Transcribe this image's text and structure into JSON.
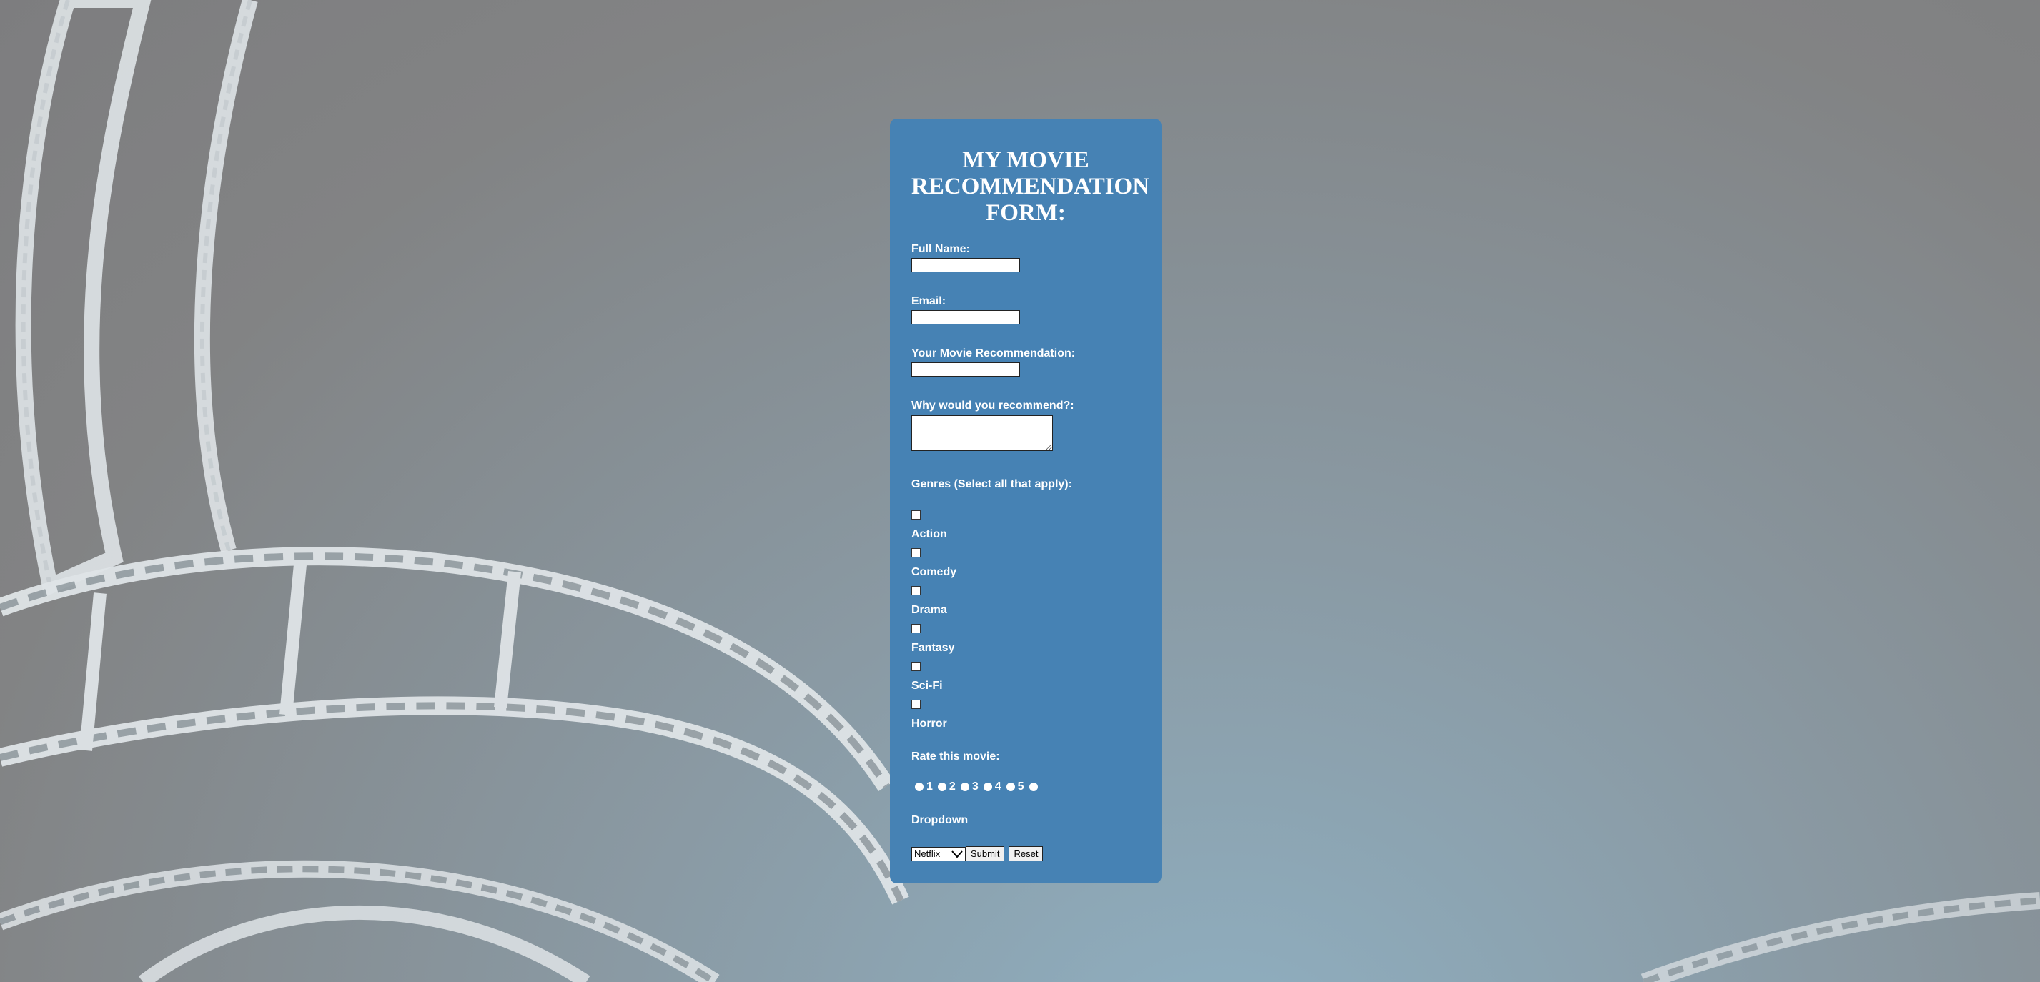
{
  "form": {
    "title": "MY MOVIE RECOMMENDATION FORM:",
    "full_name_label": "Full Name:",
    "full_name_value": "",
    "email_label": "Email:",
    "email_value": "",
    "movie_label": "Your Movie Recommendation:",
    "movie_value": "",
    "why_label": "Why would you recommend?:",
    "why_value": "",
    "genres_label": "Genres (Select all that apply):",
    "genres": [
      "Action",
      "Comedy",
      "Drama",
      "Fantasy",
      "Sci-Fi",
      "Horror"
    ],
    "rate_label": "Rate this movie:",
    "ratings": [
      "1",
      "2",
      "3",
      "4",
      "5"
    ],
    "dropdown_label": "Dropdown",
    "dropdown_selected": "Netflix",
    "submit_label": "Submit",
    "reset_label": "Reset"
  },
  "colors": {
    "card_background": "#4682b4",
    "page_background": "#828384",
    "film_strip": "#dfe4e7"
  },
  "icons": {
    "dropdown_arrow": "chevron-down-icon"
  }
}
